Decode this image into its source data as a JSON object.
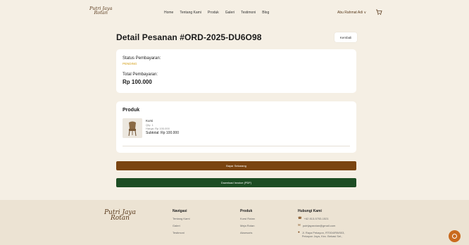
{
  "header": {
    "logo_line1": "Putri Jaya",
    "logo_line2": "Rotan",
    "nav": [
      "Home",
      "Tentang Kami",
      "Produk",
      "Galeri",
      "Testimoni",
      "Blog"
    ],
    "user_label": "Abu Rahmat Adi ∨"
  },
  "page": {
    "title": "Detail Pesanan #ORD-2025-DU6O98",
    "back_label": "Kembali"
  },
  "status_card": {
    "status_label": "Status Pembayaran:",
    "status_value": "PENDING",
    "total_label": "Total Pembayaran:",
    "total_value": "Rp 100.000"
  },
  "product_card": {
    "section_title": "Produk",
    "item": {
      "name": "Kursi",
      "qty": "Qty: 1",
      "price": "Harga: Rp 100.000",
      "subtotal": "Subtotal: Rp 100.000"
    }
  },
  "actions": {
    "pay_label": "Bayar Sekarang",
    "invoice_label": "Download Invoice (PDF)"
  },
  "footer": {
    "logo_line1": "Putri Jaya",
    "logo_line2": "Rotan",
    "nav_head": "Navigasi",
    "nav_items": [
      "Tentang Kami",
      "Galeri",
      "Testimoni"
    ],
    "prod_head": "Produk",
    "prod_items": [
      "Kursi Rotan",
      "Meja Rotan",
      "Aksesoris"
    ],
    "contact_head": "Hubungi Kami",
    "phone": "+62 813-5753-1521",
    "email": "putrijayarotan@gmail.com",
    "address1": "Jl. Raya Pekayon, RT004/RW003,",
    "address2": "Pekayon Jaya, Kec. Bekasi Sel.,"
  },
  "colors": {
    "background": "#f5efe4",
    "brand": "#5a3a1c",
    "pending": "#d4a019",
    "pay_button": "#7a4410",
    "invoice_button": "#1d4d23",
    "footer_bg": "#ece3d3",
    "chat_button": "#c96a1e"
  },
  "icons": {
    "cart": "cart-icon",
    "chat": "chat-icon",
    "phone": "phone-icon",
    "email": "email-icon",
    "location": "location-icon"
  }
}
